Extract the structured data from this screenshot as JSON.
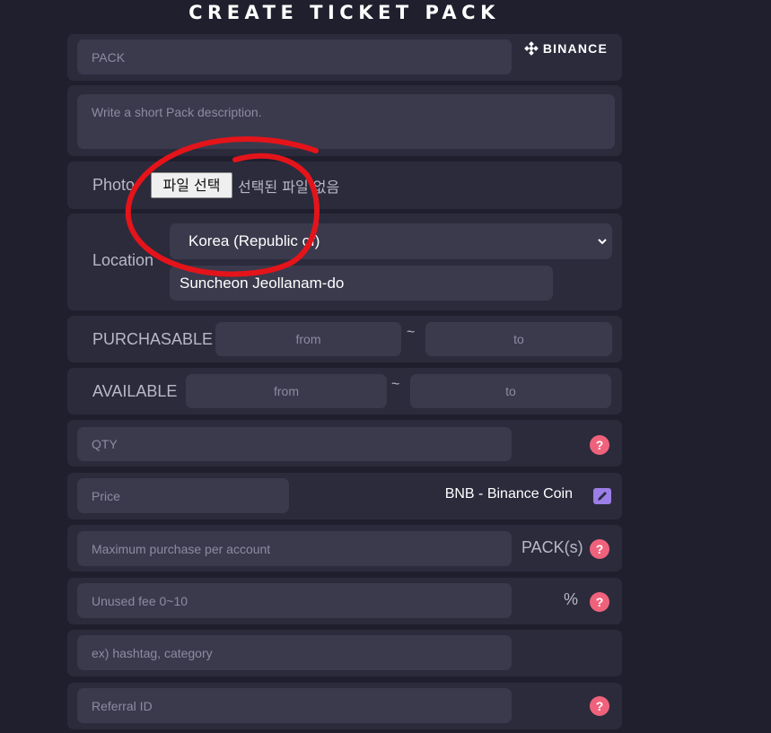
{
  "page": {
    "title": "CREATE TICKET PACK"
  },
  "pack": {
    "placeholder": "PACK",
    "brand": "BINANCE"
  },
  "description": {
    "placeholder": "Write a short Pack description."
  },
  "photo": {
    "label": "Photo",
    "button": "파일 선택",
    "status": "선택된 파일 없음"
  },
  "location": {
    "label": "Location",
    "country": "Korea (Republic of)",
    "region": "Suncheon Jeollanam-do"
  },
  "purchasable": {
    "label": "PURCHASABLE",
    "from_placeholder": "from",
    "separator": "~",
    "to_placeholder": "to"
  },
  "available": {
    "label": "AVAILABLE",
    "from_placeholder": "from",
    "separator": "~",
    "to_placeholder": "to"
  },
  "qty": {
    "placeholder": "QTY",
    "help": "?"
  },
  "price": {
    "placeholder": "Price",
    "currency": "BNB - Binance Coin"
  },
  "max_purchase": {
    "placeholder": "Maximum purchase per account",
    "unit": "PACK(s)",
    "help": "?"
  },
  "unused_fee": {
    "placeholder": "Unused fee 0~10",
    "unit": "%",
    "help": "?"
  },
  "hashtag": {
    "placeholder": "ex) hashtag, category"
  },
  "referral": {
    "placeholder": "Referral ID",
    "help": "?"
  },
  "colors": {
    "background": "#1f1f2e",
    "card": "#2b2b3c",
    "input": "#3b3a4d",
    "help": "#f0627c",
    "edit": "#9b7ee8",
    "annotation": "#e4141a"
  }
}
